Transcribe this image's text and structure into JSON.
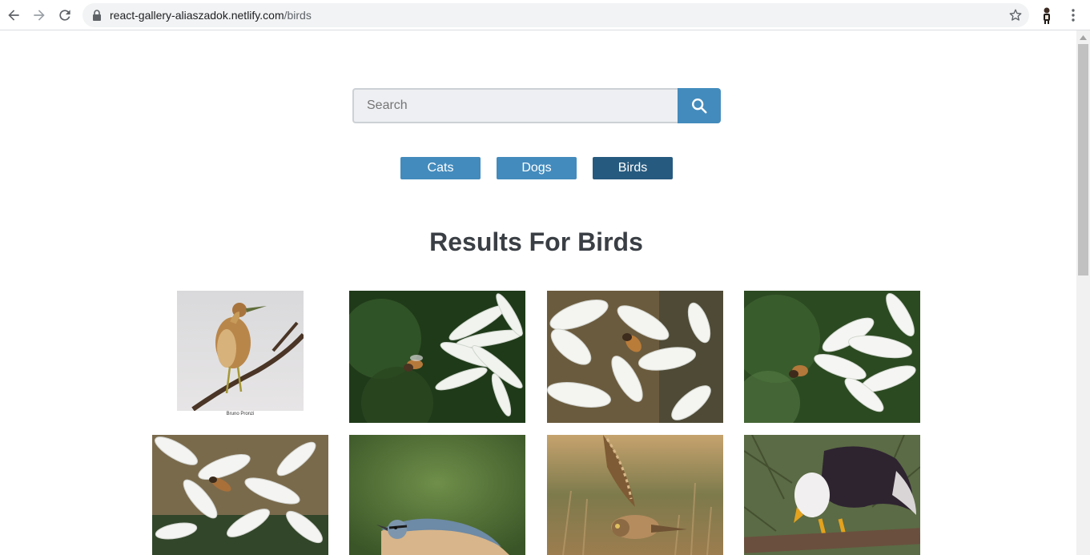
{
  "browser": {
    "url_host": "react-gallery-aliaszadok.netlify.com",
    "url_path": "/birds",
    "icons": [
      "back-arrow-icon",
      "forward-arrow-icon",
      "reload-icon",
      "lock-icon",
      "bookmark-star-icon",
      "profile-avatar",
      "more-menu-icon"
    ]
  },
  "search": {
    "placeholder": "Search",
    "value": "",
    "button_icon": "search-icon"
  },
  "topics": [
    {
      "label": "Cats",
      "active": false
    },
    {
      "label": "Dogs",
      "active": false
    },
    {
      "label": "Birds",
      "active": true
    }
  ],
  "results": {
    "title": "Results For Birds"
  },
  "photos": [
    {
      "subject": "heron-on-branch",
      "caption": "Bruno Pronzi"
    },
    {
      "subject": "bee-approaching-white-flowers"
    },
    {
      "subject": "bee-on-white-flower"
    },
    {
      "subject": "bee-hovering-near-white-flowers"
    },
    {
      "subject": "bee-on-white-blossoms"
    },
    {
      "subject": "nuthatch"
    },
    {
      "subject": "owl-in-flight"
    },
    {
      "subject": "bald-eagle-on-branch"
    }
  ],
  "colors": {
    "primary": "#438bbd",
    "active": "#275a7f",
    "title": "#3a3f45"
  }
}
